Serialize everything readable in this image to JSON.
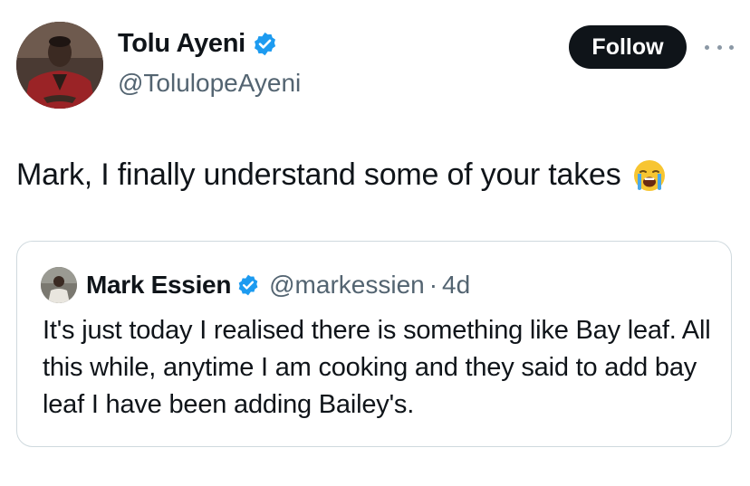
{
  "author": {
    "display_name": "Tolu Ayeni",
    "handle": "@TolulopeAyeni",
    "verified": true,
    "avatar_icon": "profile-photo"
  },
  "actions": {
    "follow_label": "Follow",
    "more_icon": "more-horizontal-icon"
  },
  "tweet": {
    "text": "Mark, I finally understand some of your takes",
    "emoji": "loudly-crying-face"
  },
  "quoted_tweet": {
    "display_name": "Mark Essien",
    "handle": "@markessien",
    "separator": "·",
    "time": "4d",
    "verified": true,
    "text": "It's just today I realised there is something like Bay leaf. All this while, anytime I am cooking and they said to add bay leaf I have been adding Bailey's."
  },
  "colors": {
    "text_primary": "#0f1419",
    "text_secondary": "#536471",
    "verified_blue": "#1d9bf0",
    "button_bg": "#0f1419",
    "border": "#cfd9de"
  }
}
